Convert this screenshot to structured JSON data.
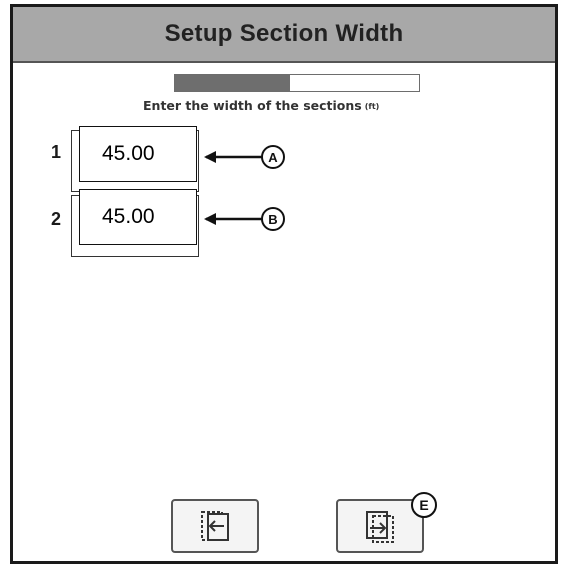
{
  "header": {
    "title": "Setup Section Width"
  },
  "progress": {
    "fraction": 0.47
  },
  "instruction": {
    "text": "Enter the width of the sections",
    "unit": "(ft)"
  },
  "sections": [
    {
      "number": "1",
      "value": "45.00",
      "callout": "A"
    },
    {
      "number": "2",
      "value": "45.00",
      "callout": "B"
    }
  ],
  "footer": {
    "next_callout": "E"
  },
  "icons": {
    "back": "back-page-icon",
    "next": "next-page-icon"
  },
  "colors": {
    "header_bg": "#a8a8a8",
    "progress_fill": "#6e6e6e",
    "frame": "#1a1a1a"
  }
}
